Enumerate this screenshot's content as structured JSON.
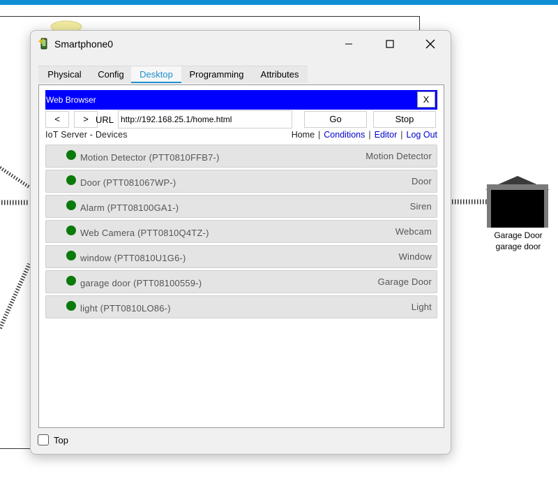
{
  "window": {
    "title": "Smartphone0"
  },
  "tabs": [
    "Physical",
    "Config",
    "Desktop",
    "Programming",
    "Attributes"
  ],
  "active_tab": "Desktop",
  "browser": {
    "title": "Web Browser",
    "close_label": "X",
    "back_label": "<",
    "forward_label": ">",
    "url_label": "URL",
    "url_value": "http://192.168.25.1/home.html",
    "go_label": "Go",
    "stop_label": "Stop"
  },
  "page": {
    "title": "IoT Server - Devices",
    "links": [
      "Home",
      "Conditions",
      "Editor",
      "Log Out"
    ]
  },
  "devices": [
    {
      "name": "Motion Detector (PTT0810FFB7-)",
      "type": "Motion Detector",
      "status_color": "#0a7a0a"
    },
    {
      "name": "Door (PTT081067WP-)",
      "type": "Door",
      "status_color": "#0a7a0a"
    },
    {
      "name": "Alarm (PTT08100GA1-)",
      "type": "Siren",
      "status_color": "#0a7a0a"
    },
    {
      "name": "Web Camera (PTT0810Q4TZ-)",
      "type": "Webcam",
      "status_color": "#0a7a0a"
    },
    {
      "name": "window (PTT0810U1G6-)",
      "type": "Window",
      "status_color": "#0a7a0a"
    },
    {
      "name": "garage door (PTT08100559-)",
      "type": "Garage Door",
      "status_color": "#0a7a0a"
    },
    {
      "name": "light (PTT0810LO86-)",
      "type": "Light",
      "status_color": "#0a7a0a"
    }
  ],
  "footer": {
    "top_label": "Top",
    "top_checked": false
  },
  "background_device": {
    "label_line1": "Garage Door",
    "label_line2": "garage door"
  },
  "colors": {
    "accent": "#1e8fd0",
    "browser_header": "#0000ff",
    "link": "#0000cc",
    "status_ok": "#0a7a0a",
    "topbar": "#0f8ed6"
  }
}
